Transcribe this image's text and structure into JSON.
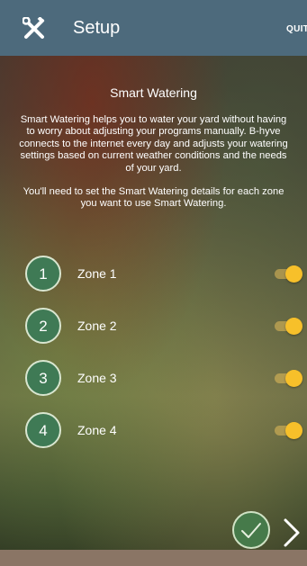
{
  "header": {
    "title": "Setup",
    "quit_label": "QUIT",
    "close_icon": "close-wrench-icon"
  },
  "main": {
    "heading": "Smart Watering",
    "paragraph1": "Smart Watering helps you to water your yard without having to worry about adjusting your programs manually. B-hyve connects to the internet every day and adjusts your watering settings based on current weather conditions and the needs of your yard.",
    "paragraph2": "You'll need to set the Smart Watering details for each zone you want to use Smart Watering."
  },
  "zones": [
    {
      "number": "1",
      "label": "Zone 1",
      "enabled": true
    },
    {
      "number": "2",
      "label": "Zone 2",
      "enabled": true
    },
    {
      "number": "3",
      "label": "Zone 3",
      "enabled": true
    },
    {
      "number": "4",
      "label": "Zone 4",
      "enabled": true
    }
  ],
  "footer": {
    "confirm_icon": "checkmark-icon",
    "next_icon": "chevron-right-icon"
  },
  "colors": {
    "topbar": "#4d6a7c",
    "zone_badge": "#3f7a55",
    "toggle_on": "#f7c02a",
    "confirm_button": "#467a4a"
  }
}
